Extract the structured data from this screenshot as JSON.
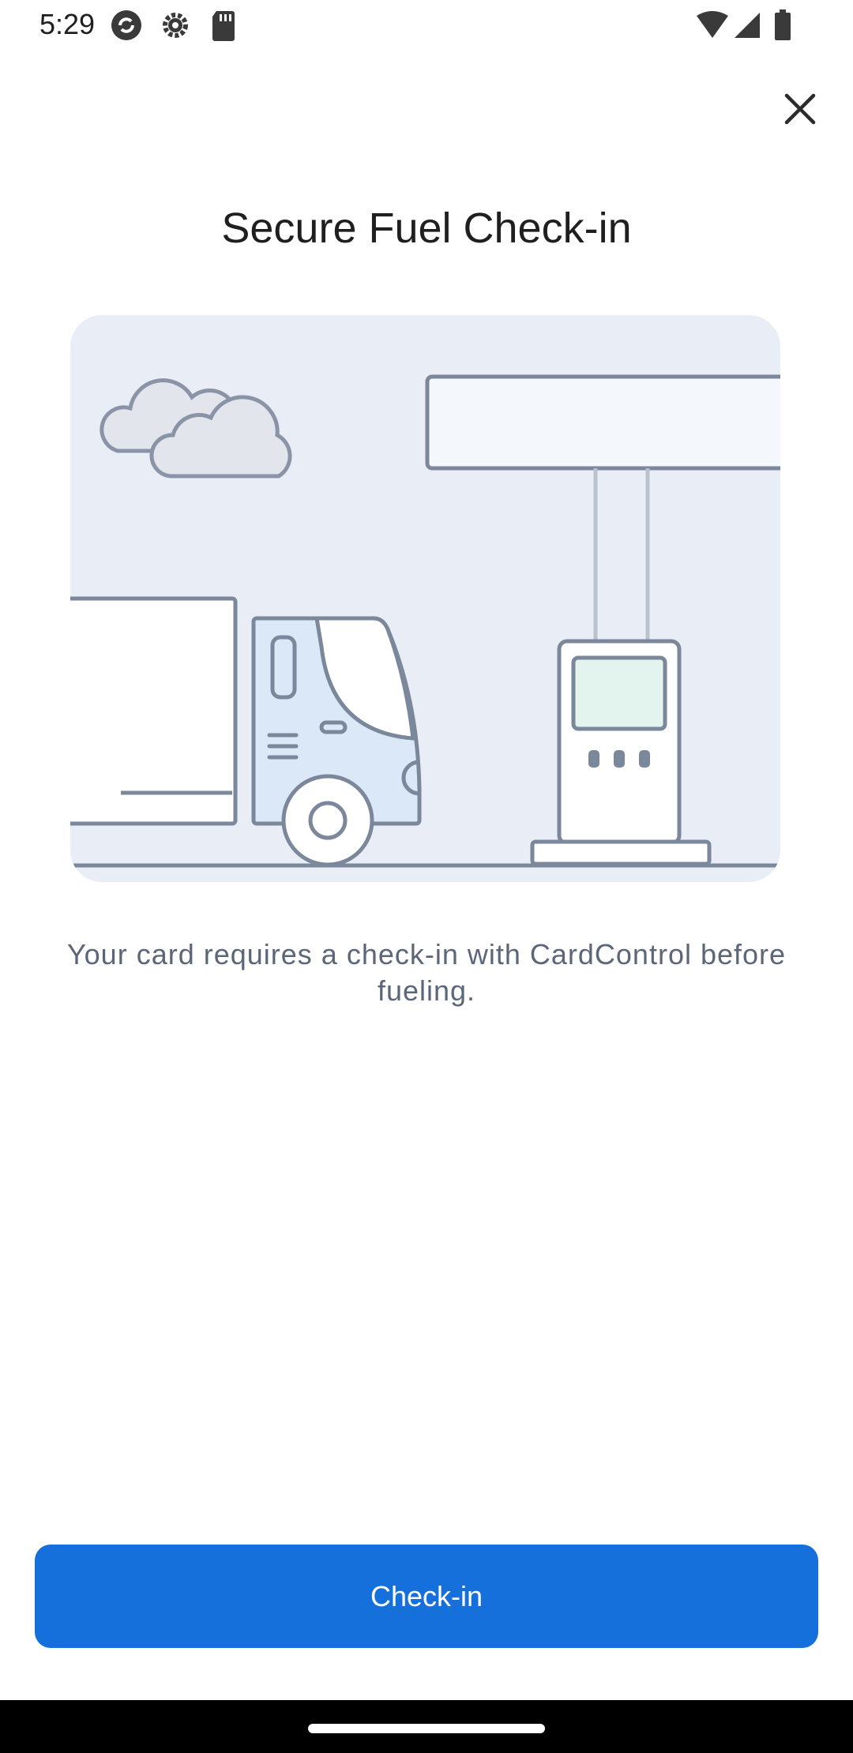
{
  "status_bar": {
    "time": "5:29",
    "left_icons": [
      "sync-icon",
      "settings-gear-icon",
      "sd-card-icon"
    ],
    "right_icons": [
      "wifi-icon",
      "cell-signal-icon",
      "battery-icon"
    ]
  },
  "header": {
    "close_icon": "close-icon"
  },
  "main": {
    "title": "Secure Fuel Check-in",
    "description": "Your card requires a check-in with CardControl before fueling.",
    "illustration": "truck-at-fuel-station"
  },
  "footer": {
    "checkin_label": "Check-in"
  },
  "colors": {
    "primary": "#1570dc",
    "illustration_bg": "#e9eef6",
    "line": "#7b879a",
    "text_secondary": "#5b6779"
  }
}
